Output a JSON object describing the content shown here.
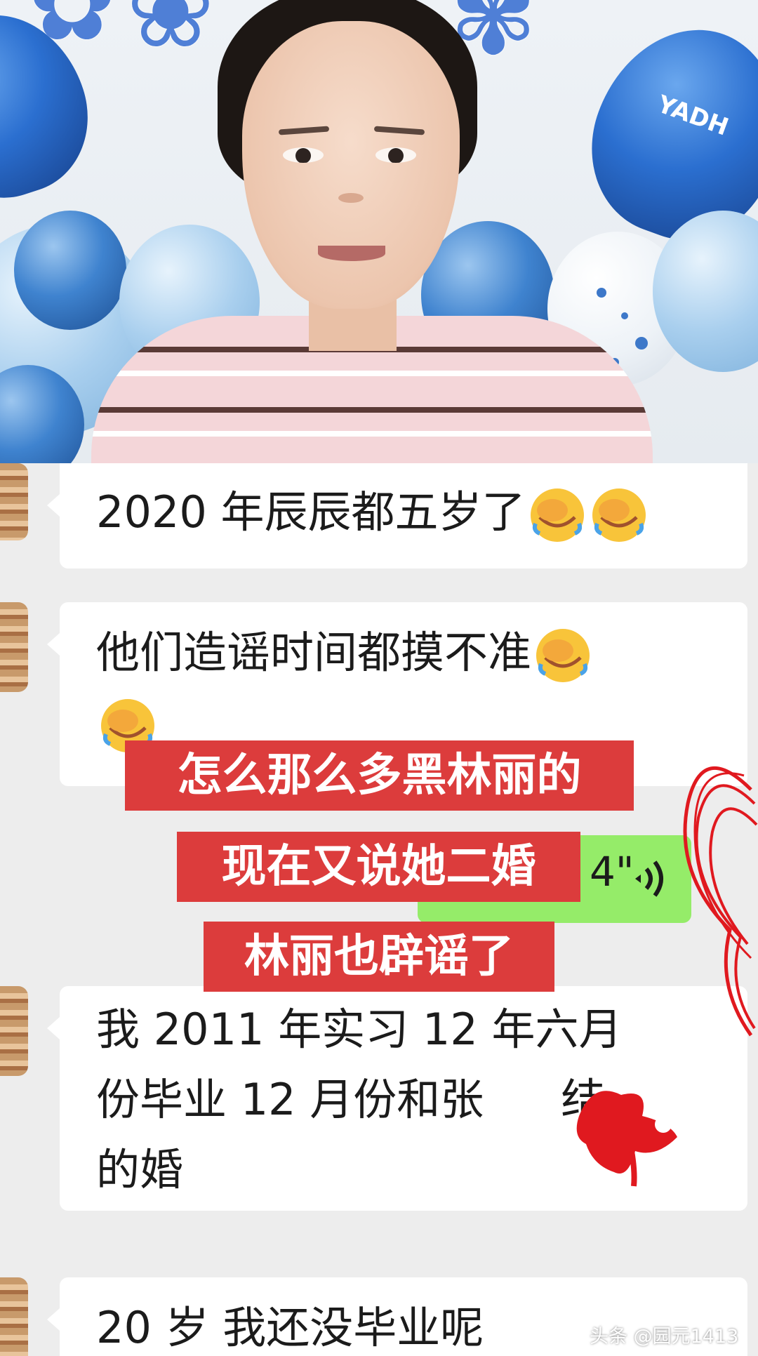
{
  "photo": {
    "balloon_text": "YADH"
  },
  "messages": [
    {
      "lines": [
        "2020 年辰辰都五岁了"
      ],
      "emoji_count": 2
    },
    {
      "lines": [
        "他们造谣时间都摸不准"
      ],
      "emoji_trailing": 1,
      "emoji_next_line": 1
    },
    {
      "lines": [
        "我 2011 年实习 12 年六月",
        "份毕业 12 月份和张",
        "的婚"
      ],
      "tail_after_redaction": "结"
    },
    {
      "lines": [
        "20 岁 我还没毕业呢"
      ]
    }
  ],
  "voice_message": {
    "duration": "4\""
  },
  "captions": [
    "怎么那么多黑林丽的",
    "现在又说她二婚",
    "林丽也辟谣了"
  ],
  "watermark": "头条 @园元1413",
  "colors": {
    "caption_bg": "#dc3c3c",
    "voice_bubble": "#95ec69",
    "chat_bg": "#ededed",
    "scribble": "#e0191f"
  },
  "icons": [
    "facepalm-emoji-icon",
    "voice-wave-icon",
    "avatar-thumbnail"
  ]
}
